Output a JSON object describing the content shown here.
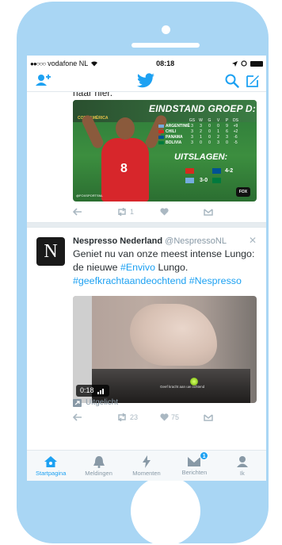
{
  "status_bar": {
    "carrier": "vodafone NL",
    "time": "08:18"
  },
  "timeline": {
    "partial_text": "naar hier.",
    "tweet1": {
      "media": {
        "heading": "EINDSTAND GROEP D:",
        "columns": [
          "GS",
          "W",
          "G",
          "V",
          "P",
          "DS"
        ],
        "standings": [
          {
            "team": "ARGENTINIË",
            "values": [
              "3",
              "3",
              "0",
              "0",
              "9",
              "+9"
            ],
            "color": "#74acdf"
          },
          {
            "team": "CHILI",
            "values": [
              "3",
              "2",
              "0",
              "1",
              "6",
              "+2"
            ],
            "color": "#d52b1e"
          },
          {
            "team": "PANAMA",
            "values": [
              "3",
              "1",
              "0",
              "2",
              "3",
              "-6"
            ],
            "color": "#005293"
          },
          {
            "team": "BOLIVIA",
            "values": [
              "3",
              "0",
              "0",
              "3",
              "0",
              "-5"
            ],
            "color": "#007a3d"
          }
        ],
        "sub_heading": "UITSLAGEN:",
        "results": [
          "4-2",
          "3-0"
        ],
        "shirt_number": "8",
        "logo_text": "COPA AMÉRICA",
        "credit": "@FOXSPORTSNL",
        "watermark": "FOX"
      },
      "actions": {
        "retweets": "1"
      }
    },
    "tweet2": {
      "name": "Nespresso Nederland",
      "handle": "@NespressoNL",
      "avatar_letter": "N",
      "text_line1": "Geniet nu van onze meest intense Lungo:",
      "text_line2_prefix": "de nieuwe ",
      "text_line2_link": "#Envivo",
      "text_line2_suffix": " Lungo.",
      "text_line3": "#geefkrachtaandeochtend #Nespresso",
      "video": {
        "duration": "0:18",
        "caption": "Geef kracht aan uw ochtend"
      },
      "actions": {
        "retweets": "23",
        "likes": "75"
      },
      "highlighted_label": "Uitgelicht"
    }
  },
  "tab_bar": {
    "tabs": [
      {
        "label": "Startpagina",
        "icon": "home-icon",
        "active": true
      },
      {
        "label": "Meldingen",
        "icon": "bell-icon",
        "active": false
      },
      {
        "label": "Momenten",
        "icon": "lightning-icon",
        "active": false
      },
      {
        "label": "Berichten",
        "icon": "envelope-icon",
        "active": false,
        "badge": "1"
      },
      {
        "label": "Ik",
        "icon": "person-icon",
        "active": false
      }
    ]
  },
  "colors": {
    "accent": "#1da1f2",
    "frame": "#a9d6f4",
    "muted": "#8899a6"
  }
}
